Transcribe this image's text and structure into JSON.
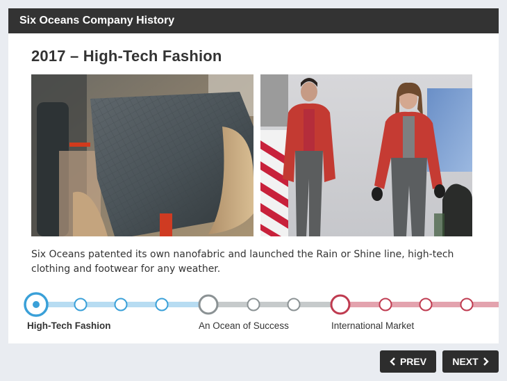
{
  "header": {
    "title": "Six Oceans Company History"
  },
  "slide": {
    "heading": "2017 – High-Tech Fashion",
    "description": "Six Oceans patented its own nanofabric and launched the Rain or Shine line, high-tech clothing and footwear for any weather.",
    "images": [
      {
        "name": "nanofabric-roll-photo"
      },
      {
        "name": "runway-models-photo"
      }
    ]
  },
  "timeline": {
    "sections": [
      {
        "label": "High-Tech Fashion",
        "color": "#3aa0d8",
        "track_color": "#b7dcf2",
        "active": true,
        "sub_steps": 3
      },
      {
        "label": "An Ocean of Success",
        "color": "#8b9294",
        "track_color": "#c6cacb",
        "active": false,
        "sub_steps": 2
      },
      {
        "label": "International Market",
        "color": "#bf3b50",
        "track_color": "#e3a3ae",
        "active": false,
        "sub_steps": 3
      }
    ]
  },
  "nav": {
    "prev_label": "PREV",
    "next_label": "NEXT",
    "prev_icon": "chevron-left-icon",
    "next_icon": "chevron-right-icon"
  }
}
